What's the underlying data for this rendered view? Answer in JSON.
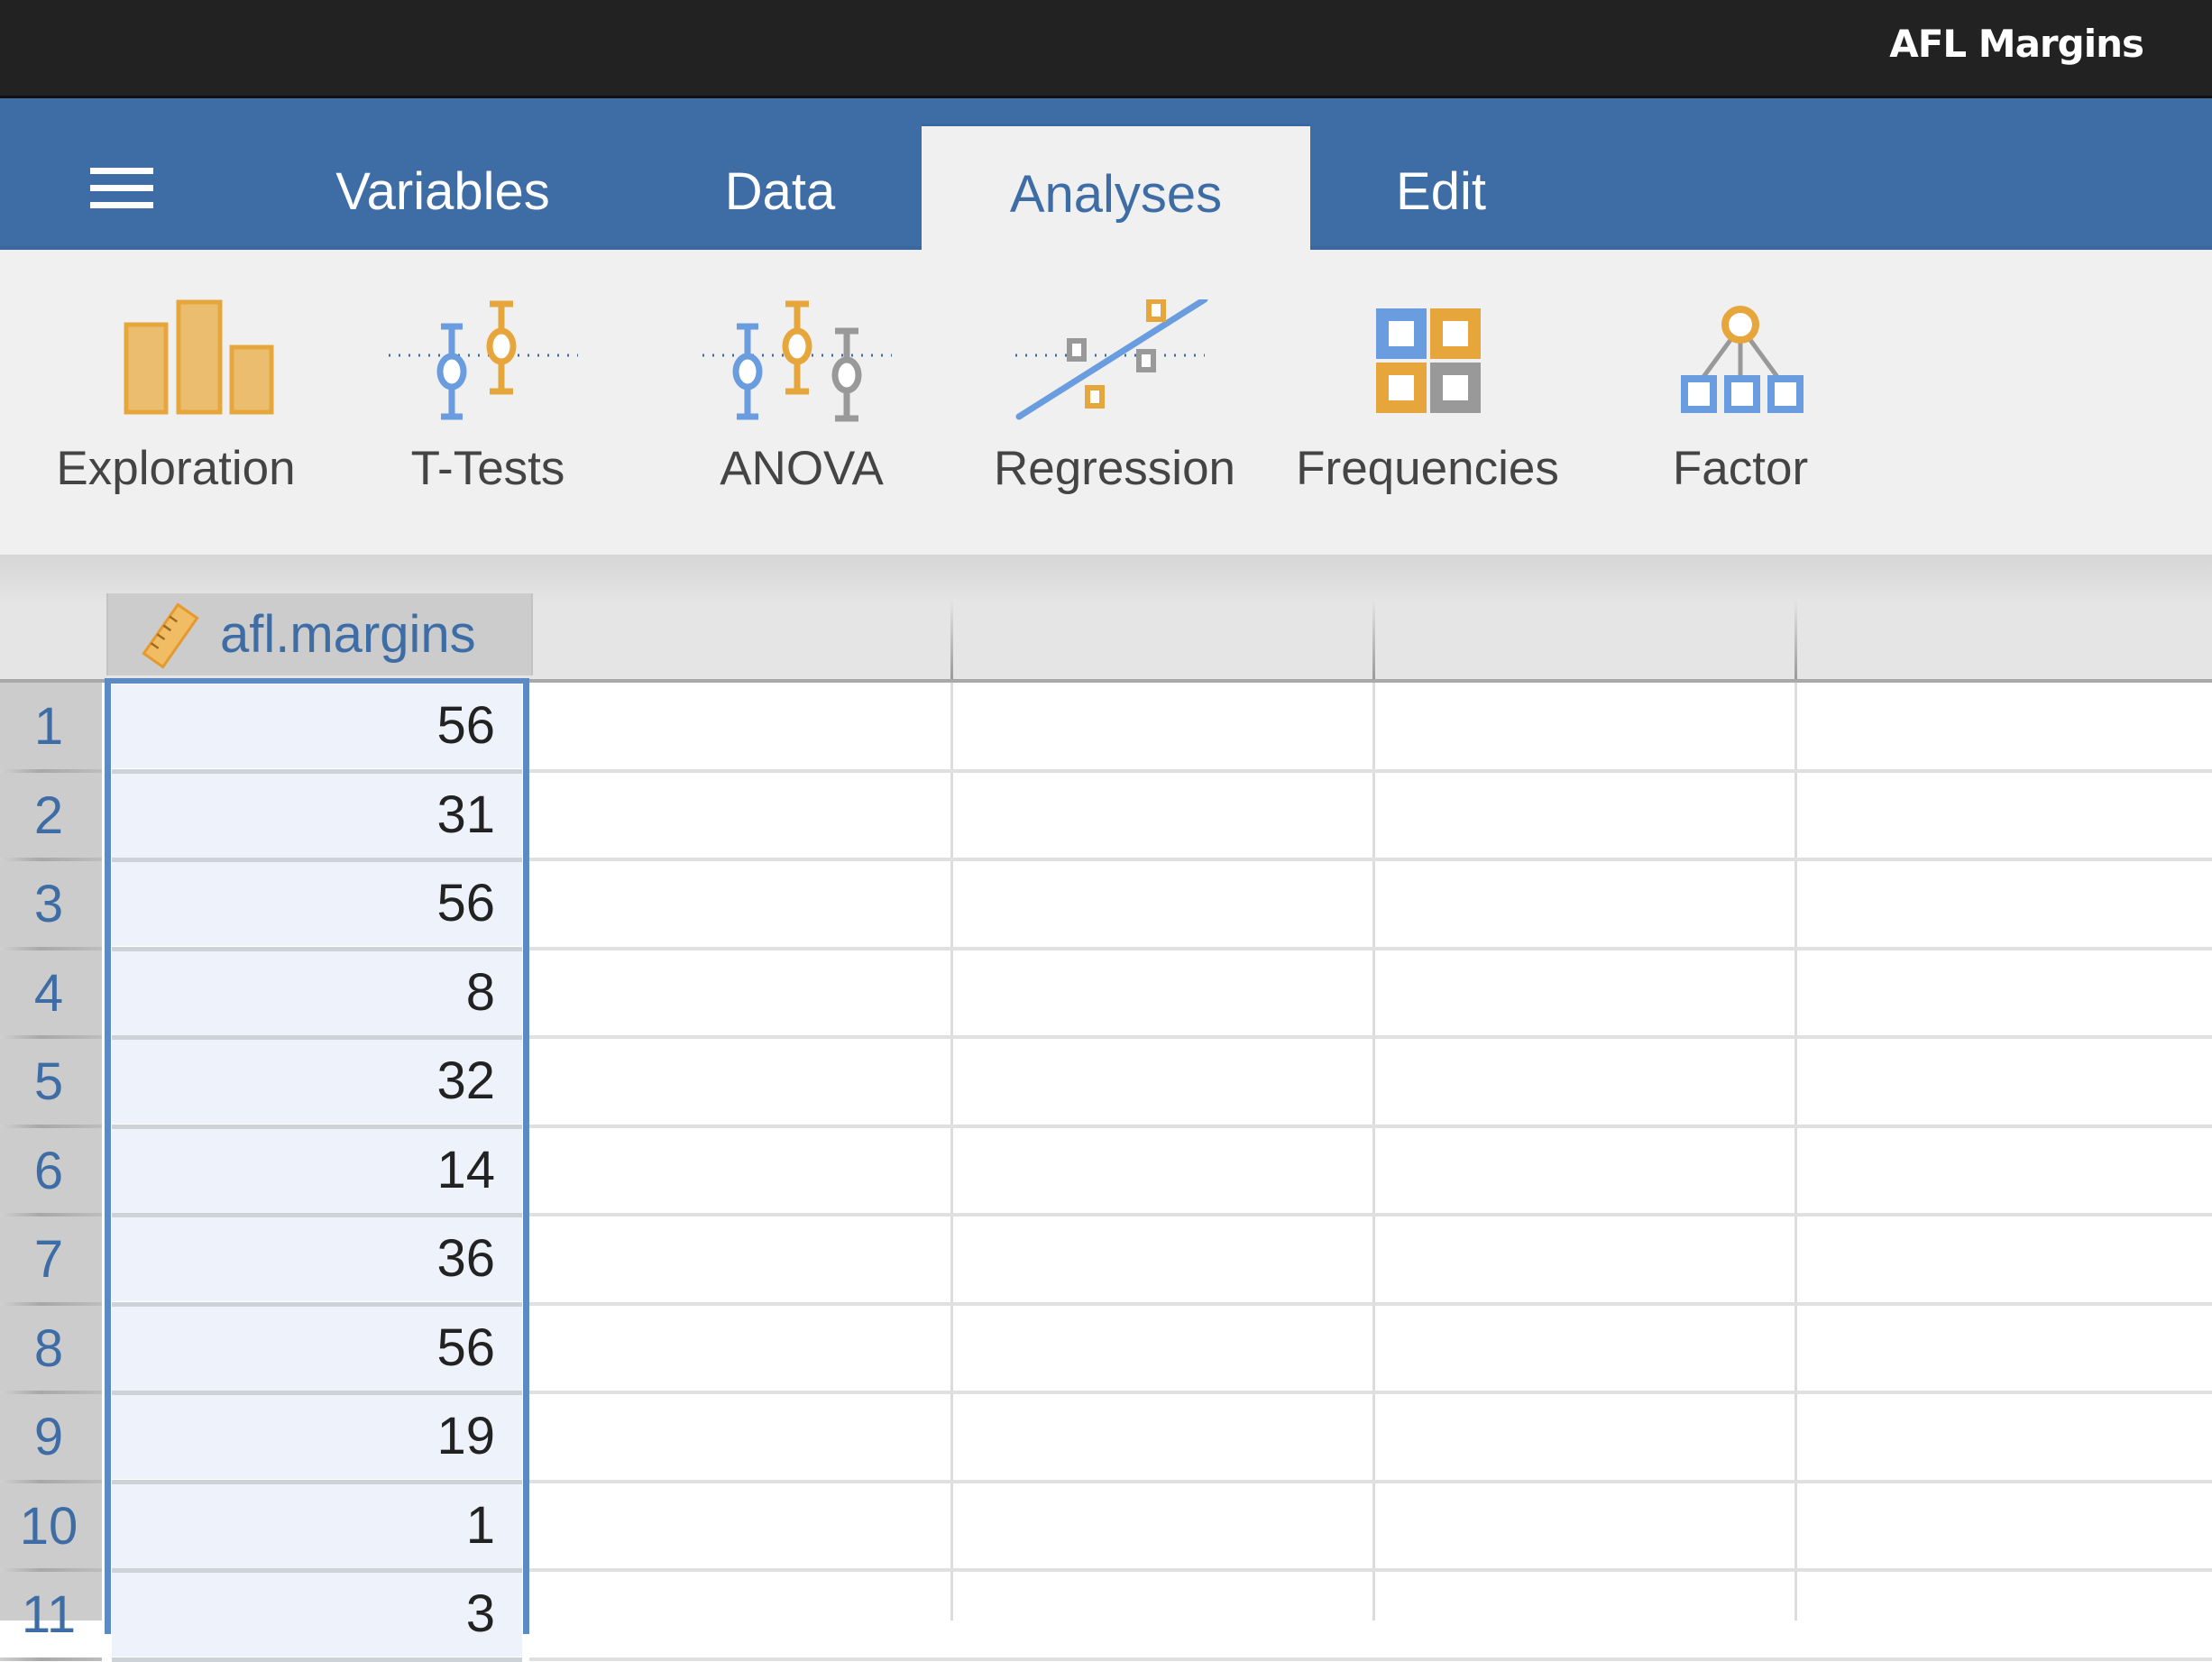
{
  "window": {
    "title": "AFL Margins"
  },
  "menu": {
    "icon": "hamburger-menu-icon"
  },
  "tabs": [
    {
      "label": "Variables",
      "active": false
    },
    {
      "label": "Data",
      "active": false
    },
    {
      "label": "Analyses",
      "active": true
    },
    {
      "label": "Edit",
      "active": false
    }
  ],
  "ribbon": [
    {
      "label": "Exploration",
      "icon": "bar-chart-icon"
    },
    {
      "label": "T-Tests",
      "icon": "ttest-icon"
    },
    {
      "label": "ANOVA",
      "icon": "anova-icon"
    },
    {
      "label": "Regression",
      "icon": "regression-icon"
    },
    {
      "label": "Frequencies",
      "icon": "frequencies-icon"
    },
    {
      "label": "Factor",
      "icon": "factor-icon"
    }
  ],
  "colors": {
    "accent_blue": "#3e6da6",
    "selection_blue": "#5b8ac5",
    "icon_orange": "#e6a63c",
    "icon_blue": "#6a9ce0",
    "icon_gray": "#999999"
  },
  "spreadsheet": {
    "columns": [
      {
        "name": "afl.margins",
        "measure_type": "continuous",
        "icon": "ruler-icon",
        "selected": true
      },
      {
        "name": ""
      },
      {
        "name": ""
      },
      {
        "name": ""
      }
    ],
    "rows": [
      {
        "n": "1",
        "value": "56"
      },
      {
        "n": "2",
        "value": "31"
      },
      {
        "n": "3",
        "value": "56"
      },
      {
        "n": "4",
        "value": "8"
      },
      {
        "n": "5",
        "value": "32"
      },
      {
        "n": "6",
        "value": "14"
      },
      {
        "n": "7",
        "value": "36"
      },
      {
        "n": "8",
        "value": "56"
      },
      {
        "n": "9",
        "value": "19"
      },
      {
        "n": "10",
        "value": "1"
      },
      {
        "n": "11",
        "value": "3"
      }
    ]
  }
}
